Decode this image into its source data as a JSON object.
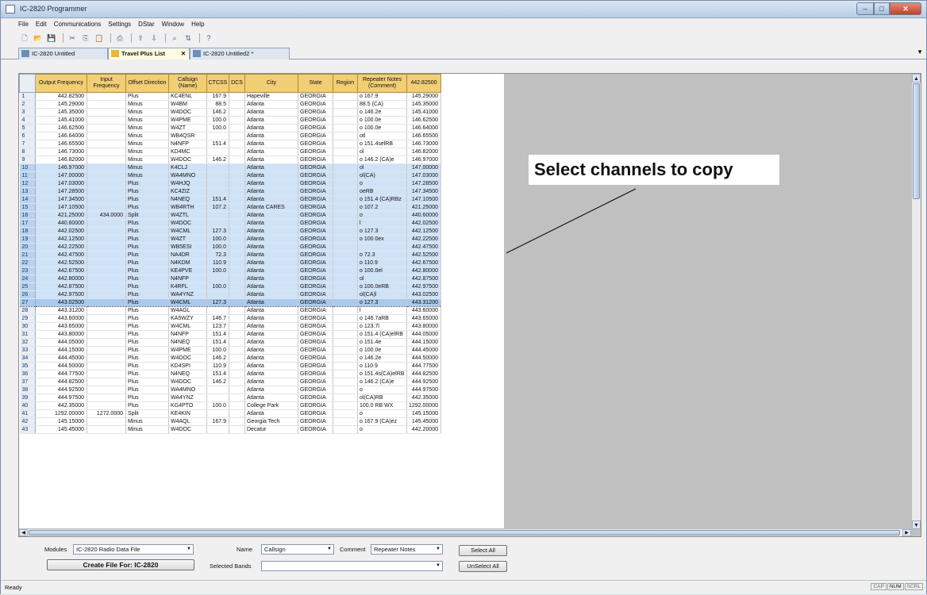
{
  "window": {
    "title": "IC-2820 Programmer"
  },
  "menu": [
    "File",
    "Edit",
    "Communications",
    "Settings",
    "DStar",
    "Window",
    "Help"
  ],
  "tabs": [
    {
      "label": "IC-2820 Untitled",
      "active": false,
      "closable": false
    },
    {
      "label": "Travel Plus List",
      "active": true,
      "closable": true
    },
    {
      "label": "IC-2820 Untitled2 *",
      "active": false,
      "closable": false
    }
  ],
  "grid": {
    "headers": [
      "Output Frequency",
      "Input Frequency",
      "Offset Direction",
      "Callsign (Name)",
      "CTCSS",
      "DCS",
      "City",
      "State",
      "Region",
      "Repeater Notes (Comment)",
      "442.82500"
    ],
    "rows": [
      [
        "1",
        "442.82500",
        "",
        "Plus",
        "KC4ENL",
        "167.9",
        "",
        "Hapeville",
        "GEORGIA",
        "",
        "o 167.9",
        "145.29000"
      ],
      [
        "2",
        "145.29000",
        "",
        "Minus",
        "W4BM",
        "88.5",
        "",
        "Atlanta",
        "GEORGIA",
        "",
        "88.5 (CA)",
        "145.35000"
      ],
      [
        "3",
        "145.35000",
        "",
        "Minus",
        "W4DOC",
        "146.2",
        "",
        "Atlanta",
        "GEORGIA",
        "",
        "o 146.2e",
        "145.41000"
      ],
      [
        "4",
        "145.41000",
        "",
        "Minus",
        "W4PME",
        "100.0",
        "",
        "Atlanta",
        "GEORGIA",
        "",
        "o 100.0e",
        "146.62500"
      ],
      [
        "5",
        "146.62500",
        "",
        "Minus",
        "W4ZT",
        "100.0",
        "",
        "Atlanta",
        "GEORGIA",
        "",
        "o 100.0e",
        "146.64000"
      ],
      [
        "6",
        "146.64000",
        "",
        "Minus",
        "WB4QSR",
        "",
        "",
        "Atlanta",
        "GEORGIA",
        "",
        "otl",
        "146.65500"
      ],
      [
        "7",
        "146.65500",
        "",
        "Minus",
        "N4NFP",
        "151.4",
        "",
        "Atlanta",
        "GEORGIA",
        "",
        "o 151.4selRB",
        "146.73000"
      ],
      [
        "8",
        "146.73000",
        "",
        "Minus",
        "KD4MC",
        "",
        "",
        "Atlanta",
        "GEORGIA",
        "",
        "ol",
        "146.82000"
      ],
      [
        "9",
        "146.82000",
        "",
        "Minus",
        "W4DOC",
        "146.2",
        "",
        "Atlanta",
        "GEORGIA",
        "",
        "o 146.2 (CA)e",
        "146.97000"
      ],
      [
        "10",
        "146.97000",
        "",
        "Minus",
        "K4CLJ",
        "",
        "",
        "Atlanta",
        "GEORGIA",
        "",
        "ol",
        "147.00000"
      ],
      [
        "11",
        "147.00000",
        "",
        "Minus",
        "WA4MNO",
        "",
        "",
        "Atlanta",
        "GEORGIA",
        "",
        "ol(CA)",
        "147.03000"
      ],
      [
        "12",
        "147.03000",
        "",
        "Plus",
        "W4HJQ",
        "",
        "",
        "Atlanta",
        "GEORGIA",
        "",
        "o",
        "147.28500"
      ],
      [
        "13",
        "147.28500",
        "",
        "Plus",
        "KC4ZIZ",
        "",
        "",
        "Atlanta",
        "GEORGIA",
        "",
        "oeRB",
        "147.34500"
      ],
      [
        "14",
        "147.34500",
        "",
        "Plus",
        "N4NEQ",
        "151.4",
        "",
        "Atlanta",
        "GEORGIA",
        "",
        "o 151.4 (CA)RBz",
        "147.10500"
      ],
      [
        "15",
        "147.10500",
        "",
        "Plus",
        "WB4RTH",
        "107.2",
        "",
        "Atlanta CARES",
        "GEORGIA",
        "",
        "o 107.2",
        "421.25000"
      ],
      [
        "16",
        "421.25000",
        "434.0000",
        "Split",
        "W4ZTL",
        "",
        "",
        "Atlanta",
        "GEORGIA",
        "",
        "o",
        "440.60000"
      ],
      [
        "17",
        "440.60000",
        "",
        "Plus",
        "W4DOC",
        "",
        "",
        "Atlanta",
        "GEORGIA",
        "",
        "l",
        "442.02500"
      ],
      [
        "18",
        "442.02500",
        "",
        "Plus",
        "W4CML",
        "127.3",
        "",
        "Atlanta",
        "GEORGIA",
        "",
        "o 127.3",
        "442.12500"
      ],
      [
        "19",
        "442.12500",
        "",
        "Plus",
        "W4ZT",
        "100.0",
        "",
        "Atlanta",
        "GEORGIA",
        "",
        "o 100.0ex",
        "442.22500"
      ],
      [
        "20",
        "442.22500",
        "",
        "Plus",
        "WB5ESI",
        "100.0",
        "",
        "Atlanta",
        "GEORGIA",
        "",
        "",
        "442.47500"
      ],
      [
        "21",
        "442.47500",
        "",
        "Plus",
        "NA4DR",
        "72.3",
        "",
        "Atlanta",
        "GEORGIA",
        "",
        "o 72.3",
        "442.52500"
      ],
      [
        "22",
        "442.52500",
        "",
        "Plus",
        "N4KDM",
        "110.9",
        "",
        "Atlanta",
        "GEORGIA",
        "",
        "o 110.9",
        "442.67500"
      ],
      [
        "23",
        "442.67500",
        "",
        "Plus",
        "KE4PVE",
        "100.0",
        "",
        "Atlanta",
        "GEORGIA",
        "",
        "o 100.0el",
        "442.80000"
      ],
      [
        "24",
        "442.80000",
        "",
        "Plus",
        "N4NFP",
        "",
        "",
        "Atlanta",
        "GEORGIA",
        "",
        "ol",
        "442.87500"
      ],
      [
        "25",
        "442.87500",
        "",
        "Plus",
        "K4RFL",
        "100.0",
        "",
        "Atlanta",
        "GEORGIA",
        "",
        "o 100.0eRB",
        "442.97500"
      ],
      [
        "26",
        "442.97500",
        "",
        "Plus",
        "WA4YNZ",
        "",
        "",
        "Atlanta",
        "GEORGIA",
        "",
        "ol(CA)l",
        "443.02500"
      ],
      [
        "27",
        "443.02500",
        "",
        "Plus",
        "W4CML",
        "127.3",
        "",
        "Atlanta",
        "GEORGIA",
        "",
        "o 127.3",
        "443.31200"
      ],
      [
        "28",
        "443.31200",
        "",
        "Plus",
        "W4AGL",
        "",
        "",
        "Atlanta",
        "GEORGIA",
        "",
        "l",
        "443.60000"
      ],
      [
        "29",
        "443.60000",
        "",
        "Plus",
        "KA5WZY",
        "146.7",
        "",
        "Atlanta",
        "GEORGIA",
        "",
        "o 146.7aRB",
        "443.65000"
      ],
      [
        "30",
        "443.65000",
        "",
        "Plus",
        "W4CML",
        "123.7",
        "",
        "Atlanta",
        "GEORGIA",
        "",
        "o 123.7l",
        "443.80000"
      ],
      [
        "31",
        "443.80000",
        "",
        "Plus",
        "N4NFP",
        "151.4",
        "",
        "Atlanta",
        "GEORGIA",
        "",
        "o 151.4 (CA)elRB",
        "444.05000"
      ],
      [
        "32",
        "444.05000",
        "",
        "Plus",
        "N4NEQ",
        "151.4",
        "",
        "Atlanta",
        "GEORGIA",
        "",
        "o 151.4e",
        "444.15000"
      ],
      [
        "33",
        "444.15000",
        "",
        "Plus",
        "W4PME",
        "100.0",
        "",
        "Atlanta",
        "GEORGIA",
        "",
        "o 100.0e",
        "444.45000"
      ],
      [
        "34",
        "444.45000",
        "",
        "Plus",
        "W4DOC",
        "146.2",
        "",
        "Atlanta",
        "GEORGIA",
        "",
        "o 146.2e",
        "444.50000"
      ],
      [
        "35",
        "444.50000",
        "",
        "Plus",
        "KD4SPI",
        "110.9",
        "",
        "Atlanta",
        "GEORGIA",
        "",
        "o 110.9",
        "444.77500"
      ],
      [
        "36",
        "444.77500",
        "",
        "Plus",
        "N4NEQ",
        "151.4",
        "",
        "Atlanta",
        "GEORGIA",
        "",
        "o 151.4s(CA)elRB",
        "444.82500"
      ],
      [
        "37",
        "444.82500",
        "",
        "Plus",
        "W4DOC",
        "146.2",
        "",
        "Atlanta",
        "GEORGIA",
        "",
        "o 146.2 (CA)e",
        "444.92500"
      ],
      [
        "38",
        "444.92500",
        "",
        "Plus",
        "WA4MNO",
        "",
        "",
        "Atlanta",
        "GEORGIA",
        "",
        "o",
        "444.97500"
      ],
      [
        "39",
        "444.97500",
        "",
        "Plus",
        "WA4YNZ",
        "",
        "",
        "Atlanta",
        "GEORGIA",
        "",
        "ol(CA)RB",
        "442.35000"
      ],
      [
        "40",
        "442.35000",
        "",
        "Plus",
        "KG4PTO",
        "100.0",
        "",
        "College Park",
        "GEORGIA",
        "",
        "100.0 RB WX",
        "1292.00000"
      ],
      [
        "41",
        "1292.00000",
        "1272.0000",
        "Split",
        "KE4KIN",
        "",
        "",
        "Atlanta",
        "GEORGIA",
        "",
        "o",
        "145.15000"
      ],
      [
        "42",
        "145.15000",
        "",
        "Minus",
        "W4AQL",
        "167.9",
        "",
        "Georgia Tech",
        "GEORGIA",
        "",
        "o 167.9 (CA)ez",
        "145.45000"
      ],
      [
        "43",
        "145.45000",
        "",
        "Minus",
        "W4DOC",
        "",
        "",
        "Decatur",
        "GEORGIA",
        "",
        "o",
        "442.20000"
      ]
    ]
  },
  "annotation": "Select channels to copy",
  "bottom": {
    "modules_label": "Modules",
    "modules_value": "IC-2820 Radio Data File",
    "name_label": "Name",
    "name_value": "Callsign",
    "comment_label": "Comment",
    "comment_value": "Repeater Notes",
    "select_all": "Select All",
    "unselect_all": "UnSelect All",
    "create_file": "Create File For: IC-2820",
    "selected_bands_label": "Selected Bands",
    "selected_bands_value": ""
  },
  "status": {
    "text": "Ready",
    "indicators": [
      "CAP",
      "NUM",
      "SCRL"
    ]
  }
}
